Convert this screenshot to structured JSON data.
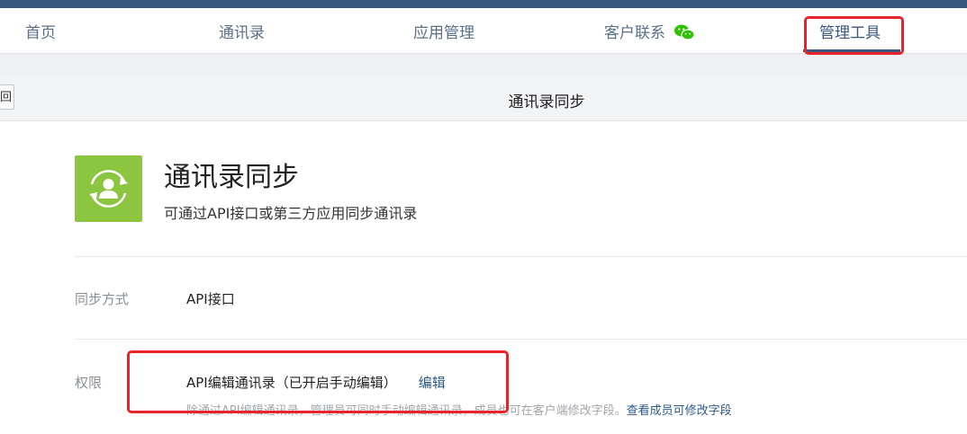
{
  "nav": {
    "items": [
      "首页",
      "通讯录",
      "应用管理",
      "客户联系",
      "管理工具"
    ],
    "active": "管理工具",
    "wechat_icon": "wechat-icon"
  },
  "subbar": {
    "back_label": "回",
    "title": "通讯录同步"
  },
  "app": {
    "icon": "contact-sync-icon",
    "icon_color": "#8cc53f",
    "title": "通讯录同步",
    "subtitle": "可通过API接口或第三方应用同步通讯录"
  },
  "settings": {
    "sync_method": {
      "label": "同步方式",
      "value": "API接口"
    },
    "permission": {
      "label": "权限",
      "value": "API编辑通讯录（已开启手动编辑）",
      "edit_link": "编辑",
      "hint": "除通过API编辑通讯录，管理员可同时手动编辑通讯录，成员也可在客户端修改字段。",
      "hint_link": "查看成员可修改字段"
    }
  },
  "colors": {
    "accent": "#3a5780",
    "highlight": "#e8242b",
    "link": "#2b5a8e"
  }
}
